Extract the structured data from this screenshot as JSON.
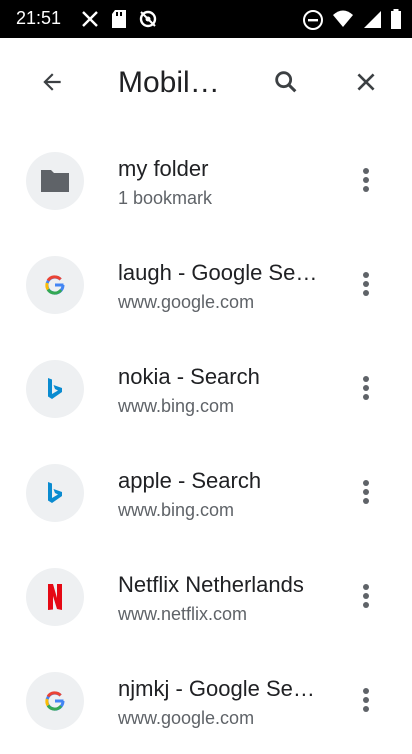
{
  "status_bar": {
    "time": "21:51"
  },
  "toolbar": {
    "title": "Mobile bookmarks"
  },
  "items": [
    {
      "title": "my folder",
      "subtitle": "1 bookmark",
      "icon": "folder-icon"
    },
    {
      "title": "laugh - Google Search",
      "subtitle": "www.google.com",
      "icon": "google-icon"
    },
    {
      "title": "nokia - Search",
      "subtitle": "www.bing.com",
      "icon": "bing-icon"
    },
    {
      "title": "apple - Search",
      "subtitle": "www.bing.com",
      "icon": "bing-icon"
    },
    {
      "title": "Netflix Netherlands",
      "subtitle": "www.netflix.com",
      "icon": "netflix-icon"
    },
    {
      "title": "njmkj - Google Search",
      "subtitle": "www.google.com",
      "icon": "google-icon"
    }
  ],
  "colors": {
    "status_bar": "#000000",
    "bing": "#0a8bd0",
    "netflix": "#e50914",
    "icon_grey": "#5f6368"
  }
}
